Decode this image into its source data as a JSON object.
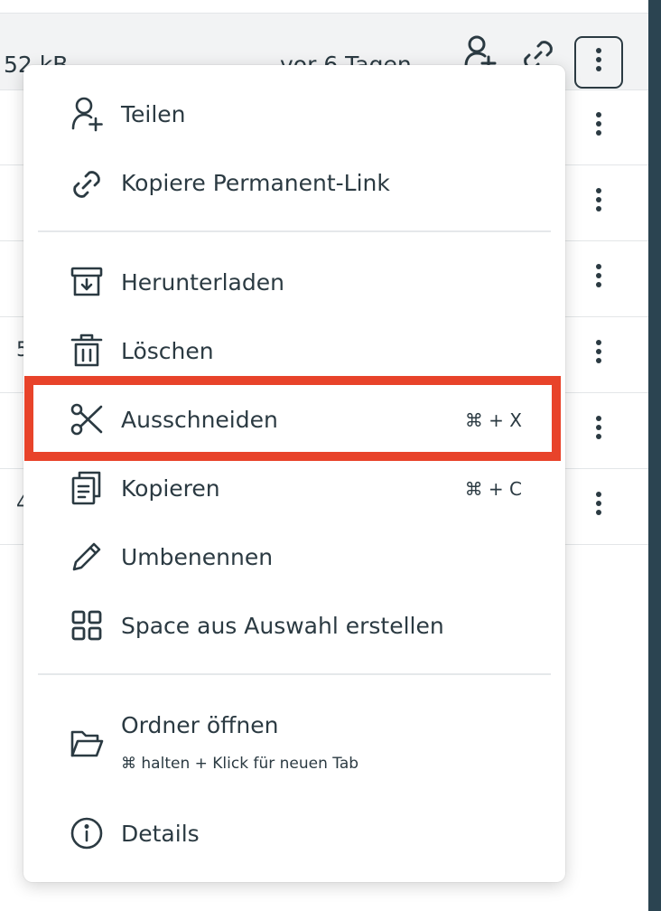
{
  "file_row": {
    "size": "52 kB",
    "modified": "vor 6 Tagen"
  },
  "partial_sizes": [
    "5",
    "4"
  ],
  "menu": {
    "items": [
      {
        "label": "Teilen",
        "icon": "user-plus-icon"
      },
      {
        "label": "Kopiere Permanent-Link",
        "icon": "link-icon"
      },
      {
        "label": "Herunterladen",
        "icon": "download-box-icon"
      },
      {
        "label": "Löschen",
        "icon": "trash-icon"
      },
      {
        "label": "Ausschneiden",
        "icon": "scissors-icon",
        "shortcut": "⌘ + X"
      },
      {
        "label": "Kopieren",
        "icon": "copy-icon",
        "shortcut": "⌘ + C"
      },
      {
        "label": "Umbenennen",
        "icon": "pencil-icon"
      },
      {
        "label": "Space aus Auswahl erstellen",
        "icon": "grid-icon"
      },
      {
        "label": "Ordner öffnen",
        "icon": "folder-open-icon",
        "hint": "⌘ halten + Klick für neuen Tab"
      },
      {
        "label": "Details",
        "icon": "info-icon"
      }
    ]
  },
  "highlight_color": "#e8432a"
}
